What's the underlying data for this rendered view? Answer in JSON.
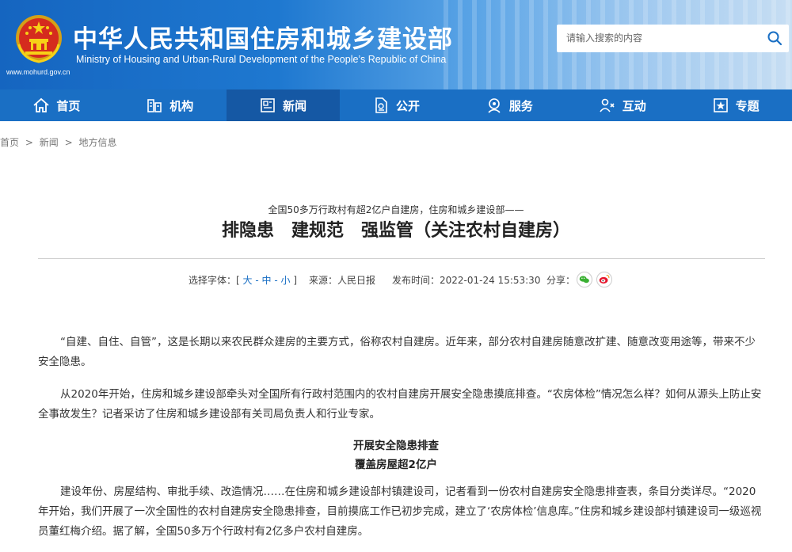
{
  "header": {
    "title_cn": "中华人民共和国住房和城乡建设部",
    "title_en": "Ministry of Housing and Urban-Rural Development of the People’s Republic of China",
    "url": "www.mohurd.gov.cn",
    "search_placeholder": "请输入搜索的内容",
    "colors": {
      "header_blue": "#1565c0",
      "nav_blue": "#1a6fc4",
      "nav_active": "#1558a4"
    }
  },
  "nav": {
    "items": [
      {
        "label": "首页",
        "icon": "home-icon"
      },
      {
        "label": "机构",
        "icon": "building-icon"
      },
      {
        "label": "新闻",
        "icon": "news-icon",
        "active": true
      },
      {
        "label": "公开",
        "icon": "document-icon"
      },
      {
        "label": "服务",
        "icon": "service-icon"
      },
      {
        "label": "互动",
        "icon": "interact-icon"
      },
      {
        "label": "专题",
        "icon": "topic-icon"
      }
    ]
  },
  "breadcrumb": {
    "home": "首页",
    "sep": ">",
    "news": "新闻",
    "current": "地方信息"
  },
  "article": {
    "subtitle": "全国50多万行政村有超2亿户自建房，住房和城乡建设部——",
    "title": "排隐患　建规范　强监管（关注农村自建房）",
    "font_label": "选择字体：[",
    "font_large": "大",
    "font_mid": "中",
    "font_small": "小",
    "font_close": "]",
    "source": "来源：人民日报",
    "time": "发布时间：2022-01-24 15:53:30",
    "share": "分享：",
    "paragraphs": [
      "“自建、自住、自管”，这是长期以来农民群众建房的主要方式，俗称农村自建房。近年来，部分农村自建房随意改扩建、随意改变用途等，带来不少安全隐患。",
      "从2020年开始，住房和城乡建设部牵头对全国所有行政村范围内的农村自建房开展安全隐患摸底排查。“农房体检”情况怎么样？如何从源头上防止安全事故发生？记者采访了住房和城乡建设部有关司局负责人和行业专家。",
      "建设年份、房屋结构、审批手续、改造情况……在住房和城乡建设部村镇建设司，记者看到一份农村自建房安全隐患排查表，条目分类详尽。“2020年开始，我们开展了一次全国性的农村自建房安全隐患排查，目前摸底工作已初步完成，建立了‘农房体检’信息库。”住房和城乡建设部村镇建设司一级巡视员董红梅介绍。据了解，全国50多万个行政村有2亿多户农村自建房。"
    ],
    "section_heading_1": "开展安全隐患排查",
    "section_heading_2": "覆盖房屋超2亿户"
  }
}
